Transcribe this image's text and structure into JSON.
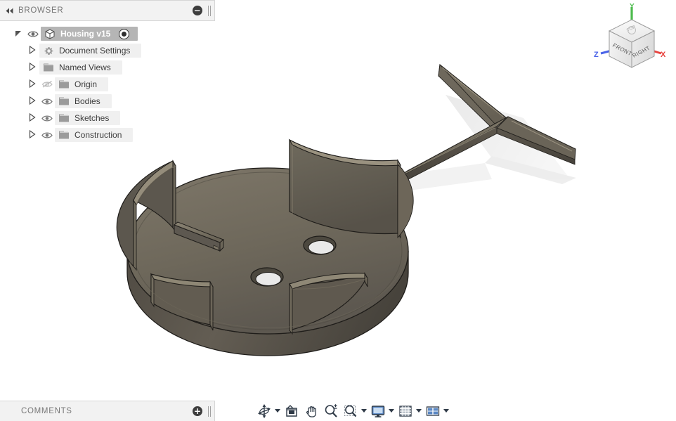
{
  "app": {
    "background": "#ffffff",
    "accent": "#b5b5b5"
  },
  "browser": {
    "title": "BROWSER",
    "collapse_icon": "double-left-arrow-icon",
    "collapse_label": "◂◂",
    "minimize_label": "−",
    "tree": [
      {
        "label": "Housing v15",
        "icon": "component-cube-icon",
        "expander": "expanded",
        "eye": "visible",
        "selected": true,
        "has_radio": true,
        "indent": 0
      },
      {
        "label": "Document Settings",
        "icon": "gear-icon",
        "expander": "collapsed",
        "eye": "none",
        "selected": false,
        "has_radio": false,
        "indent": 1
      },
      {
        "label": "Named Views",
        "icon": "folder-icon",
        "expander": "collapsed",
        "eye": "none",
        "selected": false,
        "has_radio": false,
        "indent": 1
      },
      {
        "label": "Origin",
        "icon": "folder-icon",
        "expander": "collapsed",
        "eye": "hidden",
        "selected": false,
        "has_radio": false,
        "indent": 1
      },
      {
        "label": "Bodies",
        "icon": "folder-icon",
        "expander": "collapsed",
        "eye": "visible",
        "selected": false,
        "has_radio": false,
        "indent": 1
      },
      {
        "label": "Sketches",
        "icon": "folder-icon",
        "expander": "collapsed",
        "eye": "visible",
        "selected": false,
        "has_radio": false,
        "indent": 1
      },
      {
        "label": "Construction",
        "icon": "folder-icon",
        "expander": "collapsed",
        "eye": "visible",
        "selected": false,
        "has_radio": false,
        "indent": 1
      }
    ]
  },
  "comments": {
    "title": "COMMENTS",
    "add_label": "+"
  },
  "toolbar": {
    "items": [
      {
        "name": "orbit-icon",
        "caret": true
      },
      {
        "name": "look-at-icon",
        "caret": false
      },
      {
        "name": "pan-hand-icon",
        "caret": false
      },
      {
        "name": "zoom-magnifier-icon",
        "caret": false
      },
      {
        "name": "zoom-window-icon",
        "caret": true
      },
      {
        "name": "display-settings-icon",
        "caret": true
      },
      {
        "name": "grid-snaps-icon",
        "caret": true
      },
      {
        "name": "viewports-icon",
        "caret": true
      }
    ]
  },
  "viewcube": {
    "faces": {
      "front": "FRONT",
      "right": "RIGHT",
      "top": "TOP"
    },
    "axes": [
      {
        "label": "X",
        "color": "#e8433f"
      },
      {
        "label": "Y",
        "color": "#4dbb4d"
      },
      {
        "label": "Z",
        "color": "#4a63e8"
      }
    ],
    "home_icon": "home-icon"
  },
  "model": {
    "name": "Housing v15",
    "body_color": "#6b6558",
    "body_color_light": "#8a8374",
    "body_color_dark": "#4a463d",
    "shadow_color": "#e3e3e3",
    "description": "Cylindrical housing disc with four arc walls, two through holes, a raised rib, and a T-shaped arm"
  }
}
